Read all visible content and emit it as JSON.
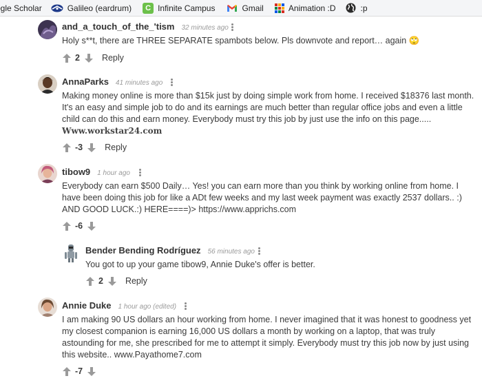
{
  "bookmarks": [
    {
      "label": "ogle Scholar",
      "icon": "none"
    },
    {
      "label": "Galileo (eardrum)",
      "icon": "galileo-icon"
    },
    {
      "label": "Infinite Campus",
      "icon": "infinite-campus-icon",
      "glyph": "C"
    },
    {
      "label": "Gmail",
      "icon": "gmail-icon"
    },
    {
      "label": "Animation :D",
      "icon": "grid-icon"
    },
    {
      "label": ":p",
      "icon": "globe-icon"
    }
  ],
  "comments": [
    {
      "author": "and_a_touch_of_the_'tism",
      "time": "32 minutes ago",
      "text": "Holy s**t, there are THREE SEPARATE spambots below. Pls downvote and report… again 🙄",
      "score": "2",
      "reply_label": "Reply"
    },
    {
      "author": "AnnaParks",
      "time": "41 minutes ago",
      "text": "Making money online is more than $15k just by doing simple work from home. I received $18376 last month. It's an easy and simple job to do and its earnings are much better than regular office jobs and even a little child can do this and earn money. Everybody must try this job by just use the info on this page.....",
      "link_text": "Www.workstar24.com",
      "score": "-3",
      "reply_label": "Reply"
    },
    {
      "author": "tibow9",
      "time": "1 hour ago",
      "text": "Everybody can earn $500 Daily… Yes! you can earn more than you think by working online from home. I have been doing this job for like a ADt few weeks and my last week payment was exactly 2537 dollars.. :) AND GOOD LUCK.:) HERE====)> https://www.apprichs.com",
      "score": "-6"
    },
    {
      "author": "Bender Bending Rodríguez",
      "time": "56 minutes ago",
      "text": "You got to up your game tibow9, Annie Duke's offer is better.",
      "score": "2",
      "reply_label": "Reply"
    },
    {
      "author": "Annie Duke",
      "time": "1 hour ago (edited)",
      "text": "I am making 90 US dollars an hour working from home. I never imagined that it was honest to goodness yet my closest companion is earning 16,000 US dollars a month by working on a laptop, that was truly astounding for me, she prescribed for me to attempt it simply. Everybody must try this job now by just using this website.. www.Payathome7.com",
      "score": "-7"
    }
  ],
  "colors": {
    "bookmarks_bg": "#f4f5f7",
    "text": "#3a3a3a",
    "time": "#9a9a9a",
    "arrow": "#9a9a9a"
  }
}
